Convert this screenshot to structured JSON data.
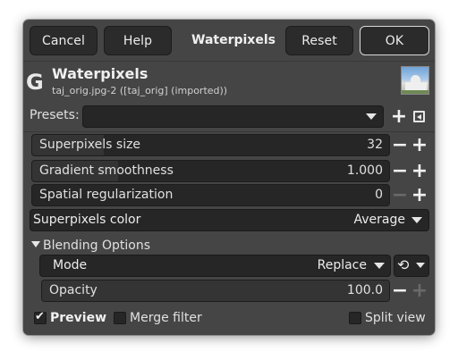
{
  "header": {
    "cancel_label": "Cancel",
    "help_label": "Help",
    "title": "Waterpixels",
    "reset_label": "Reset",
    "ok_label": "OK"
  },
  "filter": {
    "logo_glyph": "G",
    "title": "Waterpixels",
    "subtitle": "taj_orig.jpg-2 ([taj_orig] (imported))",
    "thumbnail_icon": "image-thumbnail"
  },
  "presets": {
    "label": "Presets:",
    "value": "",
    "add_icon": "plus-icon",
    "menu_icon": "presets-menu-icon"
  },
  "params": {
    "superpixels_size": {
      "label": "Superpixels size",
      "value": "32",
      "level": 0.2
    },
    "gradient_smoothness": {
      "label": "Gradient smoothness",
      "value": "1.000",
      "level": 0.24
    },
    "spatial_regularization": {
      "label": "Spatial regularization",
      "value": "0",
      "level": 0.0
    },
    "superpixels_color": {
      "label": "Superpixels color",
      "value": "Average"
    }
  },
  "blending": {
    "section_label": "Blending Options",
    "mode_label": "Mode",
    "mode_value": "Replace",
    "opacity_label": "Opacity",
    "opacity_value": "100.0",
    "opacity_level": 1.0
  },
  "footer": {
    "preview_label": "Preview",
    "preview_checked": true,
    "merge_label": "Merge filter",
    "merge_checked": false,
    "split_label": "Split view",
    "split_checked": false
  },
  "symbols": {
    "minus": "−",
    "plus": "+"
  }
}
